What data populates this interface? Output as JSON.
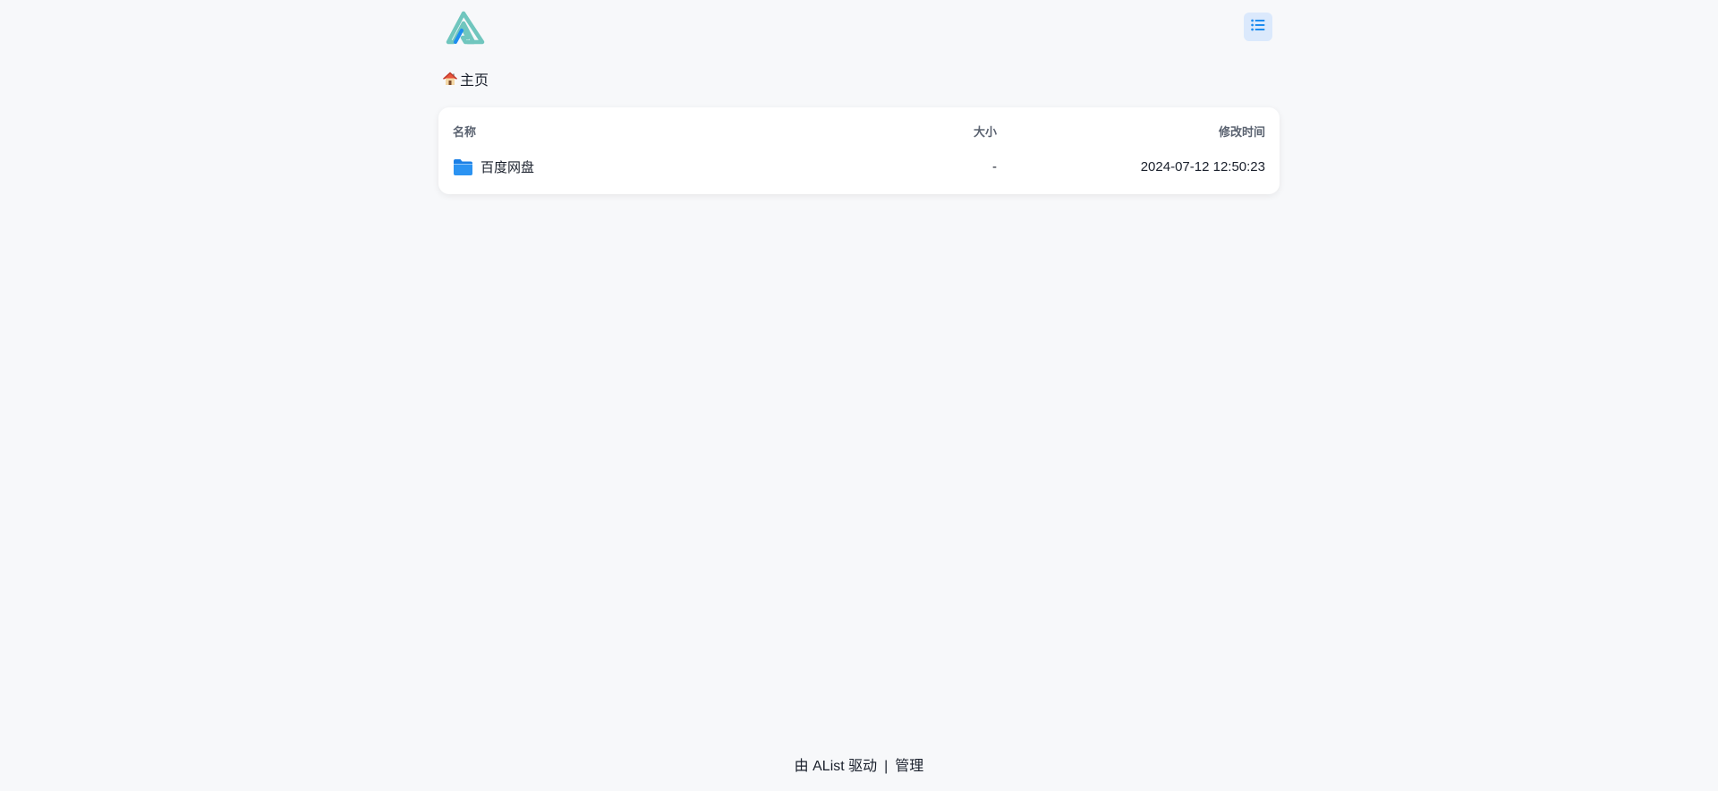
{
  "header": {
    "logo_icon": "alist-logo-icon",
    "layout_icon": "list-view-icon",
    "accent_color": "#1e8df0"
  },
  "breadcrumb": {
    "home_icon": "house-emoji-icon",
    "home_label": "主页"
  },
  "table": {
    "columns": {
      "name": "名称",
      "size": "大小",
      "modified": "修改时间"
    },
    "rows": [
      {
        "icon": "folder-icon",
        "name": "百度网盘",
        "size": "-",
        "modified": "2024-07-12 12:50:23"
      }
    ]
  },
  "footer": {
    "powered_by": "由 AList 驱动",
    "separator": "|",
    "manage_label": "管理"
  }
}
